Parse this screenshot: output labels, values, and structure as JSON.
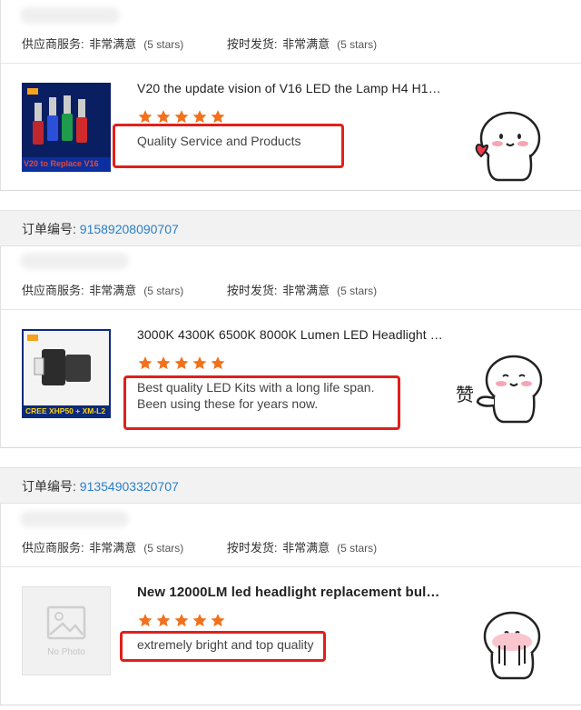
{
  "labels": {
    "supplier_service": "供应商服务:",
    "shipping": "按时发货:",
    "order_no": "订单编号:"
  },
  "star_icon_color": "#f2711c",
  "highlight_color": "#e0201c",
  "orders": [
    {
      "order_number": "",
      "supplier_service": "非常满意",
      "supplier_stars": "(5 stars)",
      "shipping": "非常满意",
      "shipping_stars": "(5 stars)",
      "product_title": "V20 the update vision of V16 LED the Lamp H4 H13H...",
      "thumb_caption": "V20 to Replace V16",
      "rating": 5,
      "review": [
        "Quality Service and Products"
      ],
      "sticker": "heart-sticker-icon"
    },
    {
      "order_number": "91589208090707",
      "supplier_service": "非常满意",
      "supplier_stars": "(5 stars)",
      "shipping": "非常满意",
      "shipping_stars": "(5 stars)",
      "product_title": "3000K 4300K 6500K 8000K Lumen LED Headlight wit...",
      "thumb_caption": "CREE XHP50 + XM-L2",
      "rating": 5,
      "review": [
        "Best quality LED Kits with a long life span.",
        "Been using these for years now."
      ],
      "sticker": "thumbs-up-sticker-icon",
      "sticker_text": "赞"
    },
    {
      "order_number": "91354903320707",
      "supplier_service": "非常满意",
      "supplier_stars": "(5 stars)",
      "shipping": "非常满意",
      "shipping_stars": "(5 stars)",
      "product_title": "New 12000LM led headlight replacement bulb ...",
      "thumb_caption": "No Photo",
      "rating": 5,
      "review": [
        "extremely bright and top quality"
      ],
      "sticker": "shy-sticker-icon"
    }
  ]
}
